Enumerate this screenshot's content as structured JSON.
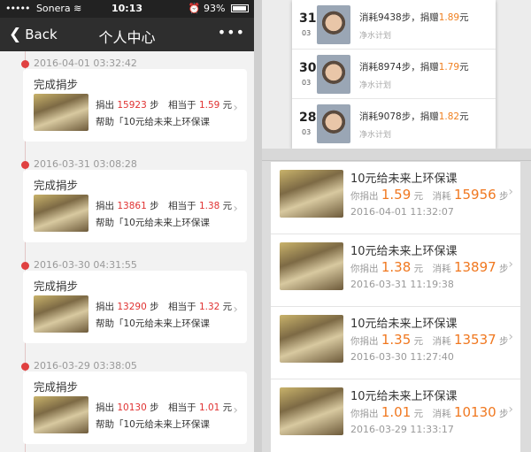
{
  "status": {
    "carrier": "Sonera",
    "time": "10:13",
    "battery": "93%"
  },
  "nav": {
    "back_label": "Back",
    "title": "个人中心",
    "more": "•••"
  },
  "timeline": [
    {
      "date": "2016-04-01 03:32:42",
      "title": "完成捐步",
      "donate_prefix": "捐出",
      "steps": "15923",
      "steps_unit": "步",
      "equiv_prefix": "相当于",
      "amount": "1.59",
      "amount_unit": "元",
      "help_text": "帮助「10元给未来上环保课"
    },
    {
      "date": "2016-03-31 03:08:28",
      "title": "完成捐步",
      "donate_prefix": "捐出",
      "steps": "13861",
      "steps_unit": "步",
      "equiv_prefix": "相当于",
      "amount": "1.38",
      "amount_unit": "元",
      "help_text": "帮助「10元给未来上环保课"
    },
    {
      "date": "2016-03-30 04:31:55",
      "title": "完成捐步",
      "donate_prefix": "捐出",
      "steps": "13290",
      "steps_unit": "步",
      "equiv_prefix": "相当于",
      "amount": "1.32",
      "amount_unit": "元",
      "help_text": "帮助「10元给未来上环保课"
    },
    {
      "date": "2016-03-29 03:38:05",
      "title": "完成捐步",
      "donate_prefix": "捐出",
      "steps": "10130",
      "steps_unit": "步",
      "equiv_prefix": "相当于",
      "amount": "1.01",
      "amount_unit": "元",
      "help_text": "帮助「10元给未来上环保课"
    }
  ],
  "popup": [
    {
      "day": "31",
      "month": "03",
      "text": "消耗9438步，捐赠",
      "amount": "1.89",
      "unit": "元",
      "project": "净水计划"
    },
    {
      "day": "30",
      "month": "03",
      "text": "消耗8974步，捐赠",
      "amount": "1.79",
      "unit": "元",
      "project": "净水计划"
    },
    {
      "day": "28",
      "month": "03",
      "text": "消耗9078步，捐赠",
      "amount": "1.82",
      "unit": "元",
      "project": "净水计划"
    }
  ],
  "records": [
    {
      "title": "10元给未来上环保课",
      "donate_label": "你捐出",
      "amount": "1.59",
      "amount_unit": "元",
      "consume_label": "消耗",
      "steps": "15956",
      "steps_unit": "步",
      "datetime": "2016-04-01 11:32:07"
    },
    {
      "title": "10元给未来上环保课",
      "donate_label": "你捐出",
      "amount": "1.38",
      "amount_unit": "元",
      "consume_label": "消耗",
      "steps": "13897",
      "steps_unit": "步",
      "datetime": "2016-03-31 11:19:38"
    },
    {
      "title": "10元给未来上环保课",
      "donate_label": "你捐出",
      "amount": "1.35",
      "amount_unit": "元",
      "consume_label": "消耗",
      "steps": "13537",
      "steps_unit": "步",
      "datetime": "2016-03-30 11:27:40"
    },
    {
      "title": "10元给未来上环保课",
      "donate_label": "你捐出",
      "amount": "1.01",
      "amount_unit": "元",
      "consume_label": "消耗",
      "steps": "10130",
      "steps_unit": "步",
      "datetime": "2016-03-29 11:33:17"
    }
  ]
}
